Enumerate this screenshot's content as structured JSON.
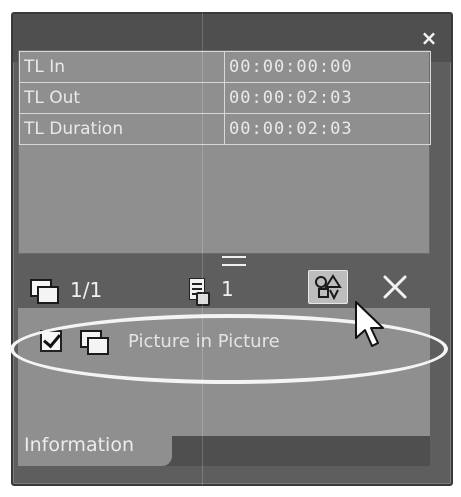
{
  "window": {
    "close_glyph": "×"
  },
  "info_table": {
    "rows": [
      {
        "label": "TL In",
        "value": "00:00:00:00"
      },
      {
        "label": "TL Out",
        "value": "00:00:02:03"
      },
      {
        "label": "TL Duration",
        "value": "00:00:02:03"
      }
    ]
  },
  "toolbar": {
    "layer_count": "1/1",
    "track_number": "1",
    "delete_glyph": "✕"
  },
  "effects": [
    {
      "name": "Picture in Picture",
      "checked": true
    }
  ],
  "tabs": {
    "active": "Information"
  },
  "icons": {
    "layers": "layers-icon",
    "track": "track-icon",
    "effect_settings": "effect-settings-icon",
    "delete": "close-icon",
    "cursor": "mouse-pointer-icon",
    "checkbox": "checkbox-checked-icon"
  },
  "colors": {
    "panel": "#5e5e5e",
    "content": "#8f8f8f",
    "title_bar": "#4f4f4f",
    "text": "#e9e9e9"
  }
}
